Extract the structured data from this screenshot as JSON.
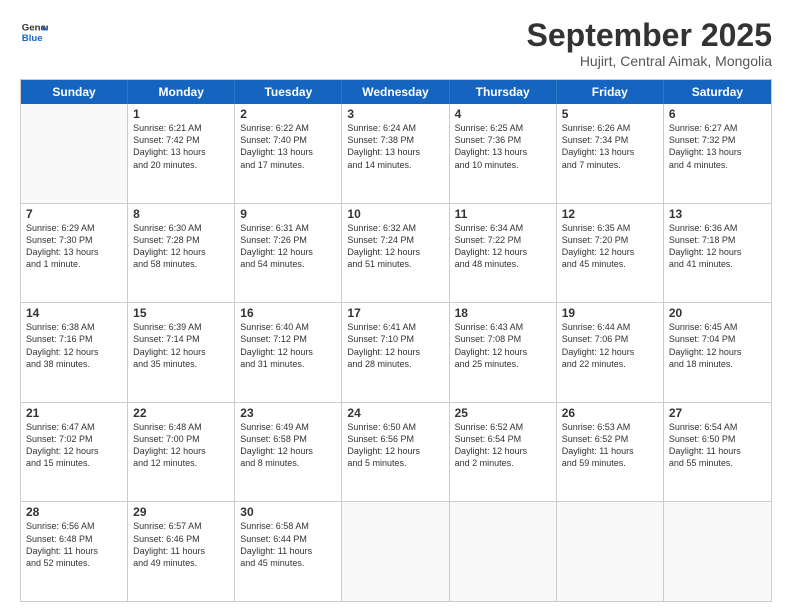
{
  "header": {
    "logo_line1": "General",
    "logo_line2": "Blue",
    "title": "September 2025",
    "subtitle": "Hujirt, Central Aimak, Mongolia"
  },
  "weekdays": [
    "Sunday",
    "Monday",
    "Tuesday",
    "Wednesday",
    "Thursday",
    "Friday",
    "Saturday"
  ],
  "weeks": [
    [
      {
        "day": "",
        "info": ""
      },
      {
        "day": "1",
        "info": "Sunrise: 6:21 AM\nSunset: 7:42 PM\nDaylight: 13 hours\nand 20 minutes."
      },
      {
        "day": "2",
        "info": "Sunrise: 6:22 AM\nSunset: 7:40 PM\nDaylight: 13 hours\nand 17 minutes."
      },
      {
        "day": "3",
        "info": "Sunrise: 6:24 AM\nSunset: 7:38 PM\nDaylight: 13 hours\nand 14 minutes."
      },
      {
        "day": "4",
        "info": "Sunrise: 6:25 AM\nSunset: 7:36 PM\nDaylight: 13 hours\nand 10 minutes."
      },
      {
        "day": "5",
        "info": "Sunrise: 6:26 AM\nSunset: 7:34 PM\nDaylight: 13 hours\nand 7 minutes."
      },
      {
        "day": "6",
        "info": "Sunrise: 6:27 AM\nSunset: 7:32 PM\nDaylight: 13 hours\nand 4 minutes."
      }
    ],
    [
      {
        "day": "7",
        "info": "Sunrise: 6:29 AM\nSunset: 7:30 PM\nDaylight: 13 hours\nand 1 minute."
      },
      {
        "day": "8",
        "info": "Sunrise: 6:30 AM\nSunset: 7:28 PM\nDaylight: 12 hours\nand 58 minutes."
      },
      {
        "day": "9",
        "info": "Sunrise: 6:31 AM\nSunset: 7:26 PM\nDaylight: 12 hours\nand 54 minutes."
      },
      {
        "day": "10",
        "info": "Sunrise: 6:32 AM\nSunset: 7:24 PM\nDaylight: 12 hours\nand 51 minutes."
      },
      {
        "day": "11",
        "info": "Sunrise: 6:34 AM\nSunset: 7:22 PM\nDaylight: 12 hours\nand 48 minutes."
      },
      {
        "day": "12",
        "info": "Sunrise: 6:35 AM\nSunset: 7:20 PM\nDaylight: 12 hours\nand 45 minutes."
      },
      {
        "day": "13",
        "info": "Sunrise: 6:36 AM\nSunset: 7:18 PM\nDaylight: 12 hours\nand 41 minutes."
      }
    ],
    [
      {
        "day": "14",
        "info": "Sunrise: 6:38 AM\nSunset: 7:16 PM\nDaylight: 12 hours\nand 38 minutes."
      },
      {
        "day": "15",
        "info": "Sunrise: 6:39 AM\nSunset: 7:14 PM\nDaylight: 12 hours\nand 35 minutes."
      },
      {
        "day": "16",
        "info": "Sunrise: 6:40 AM\nSunset: 7:12 PM\nDaylight: 12 hours\nand 31 minutes."
      },
      {
        "day": "17",
        "info": "Sunrise: 6:41 AM\nSunset: 7:10 PM\nDaylight: 12 hours\nand 28 minutes."
      },
      {
        "day": "18",
        "info": "Sunrise: 6:43 AM\nSunset: 7:08 PM\nDaylight: 12 hours\nand 25 minutes."
      },
      {
        "day": "19",
        "info": "Sunrise: 6:44 AM\nSunset: 7:06 PM\nDaylight: 12 hours\nand 22 minutes."
      },
      {
        "day": "20",
        "info": "Sunrise: 6:45 AM\nSunset: 7:04 PM\nDaylight: 12 hours\nand 18 minutes."
      }
    ],
    [
      {
        "day": "21",
        "info": "Sunrise: 6:47 AM\nSunset: 7:02 PM\nDaylight: 12 hours\nand 15 minutes."
      },
      {
        "day": "22",
        "info": "Sunrise: 6:48 AM\nSunset: 7:00 PM\nDaylight: 12 hours\nand 12 minutes."
      },
      {
        "day": "23",
        "info": "Sunrise: 6:49 AM\nSunset: 6:58 PM\nDaylight: 12 hours\nand 8 minutes."
      },
      {
        "day": "24",
        "info": "Sunrise: 6:50 AM\nSunset: 6:56 PM\nDaylight: 12 hours\nand 5 minutes."
      },
      {
        "day": "25",
        "info": "Sunrise: 6:52 AM\nSunset: 6:54 PM\nDaylight: 12 hours\nand 2 minutes."
      },
      {
        "day": "26",
        "info": "Sunrise: 6:53 AM\nSunset: 6:52 PM\nDaylight: 11 hours\nand 59 minutes."
      },
      {
        "day": "27",
        "info": "Sunrise: 6:54 AM\nSunset: 6:50 PM\nDaylight: 11 hours\nand 55 minutes."
      }
    ],
    [
      {
        "day": "28",
        "info": "Sunrise: 6:56 AM\nSunset: 6:48 PM\nDaylight: 11 hours\nand 52 minutes."
      },
      {
        "day": "29",
        "info": "Sunrise: 6:57 AM\nSunset: 6:46 PM\nDaylight: 11 hours\nand 49 minutes."
      },
      {
        "day": "30",
        "info": "Sunrise: 6:58 AM\nSunset: 6:44 PM\nDaylight: 11 hours\nand 45 minutes."
      },
      {
        "day": "",
        "info": ""
      },
      {
        "day": "",
        "info": ""
      },
      {
        "day": "",
        "info": ""
      },
      {
        "day": "",
        "info": ""
      }
    ]
  ]
}
